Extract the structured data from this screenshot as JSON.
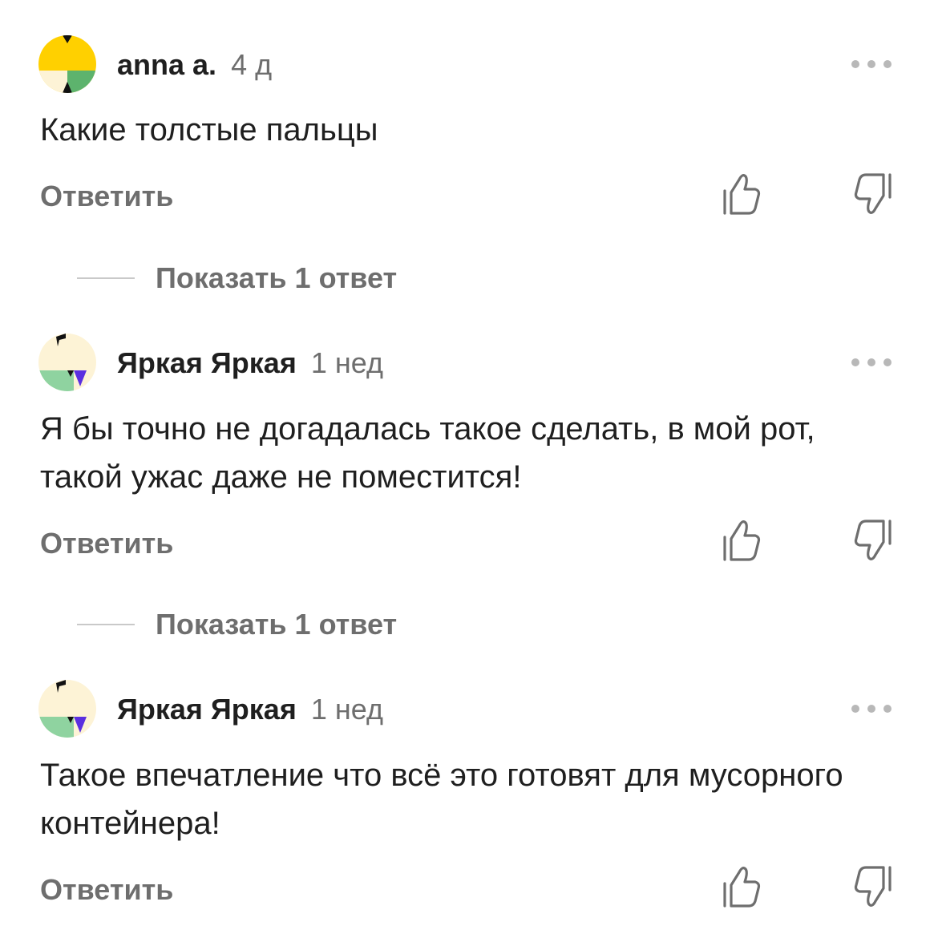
{
  "icons": {
    "more": "more-dots-icon",
    "like": "thumbs-up-icon",
    "dislike": "thumbs-down-icon"
  },
  "colors": {
    "avatar_yellow": "#ffd000",
    "avatar_cream": "#fdf3d6",
    "avatar_green": "#5db36d",
    "avatar_mint": "#8fd3a0",
    "avatar_purple": "#5a2fe0",
    "muted_text": "#6e6e6e"
  },
  "comments": [
    {
      "author": "anna a.",
      "time": "4 д",
      "text": "Какие толстые пальцы",
      "reply_label": "Ответить",
      "show_replies": "Показать 1 ответ"
    },
    {
      "author": "Яркая Яркая",
      "time": "1 нед",
      "text": "Я бы точно не догадалась такое сделать, в мой рот, такой ужас даже не поместится!",
      "reply_label": "Ответить",
      "show_replies": "Показать 1 ответ"
    },
    {
      "author": "Яркая Яркая",
      "time": "1 нед",
      "text": "Такое впечатление что всё это готовят для мусорного контейнера!",
      "reply_label": "Ответить"
    }
  ]
}
